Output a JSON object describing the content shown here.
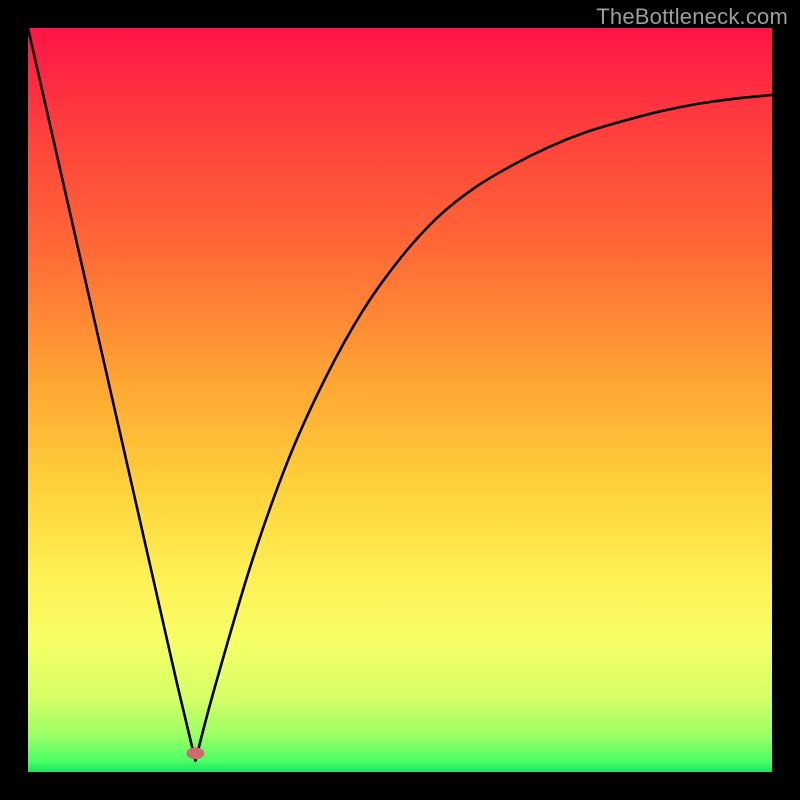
{
  "watermark": "TheBottleneck.com",
  "chart_data": {
    "type": "line",
    "title": "",
    "xlabel": "",
    "ylabel": "",
    "xlim": [
      0,
      100
    ],
    "ylim": [
      0,
      100
    ],
    "grid": false,
    "legend": false,
    "notes": "Heat-map background (red→orange→yellow→green vertical gradient). Black V-shaped curve: steep nearly-linear descent from top-left to a cusp near x≈22, then concave-up rise approaching top-right. Small red-rose marker at the cusp.",
    "marker": {
      "x": 22.5,
      "y": 2.5,
      "color": "#cf6a6f"
    },
    "series": [
      {
        "name": "curve",
        "x": [
          0,
          5,
          10,
          15,
          20,
          22.5,
          25,
          30,
          35,
          40,
          45,
          50,
          55,
          60,
          65,
          70,
          75,
          80,
          85,
          90,
          95,
          100
        ],
        "y": [
          100,
          78,
          56,
          34,
          12,
          1.5,
          11,
          28,
          42,
          53,
          62,
          69,
          74.5,
          78.5,
          81.5,
          84,
          86,
          87.5,
          88.8,
          89.8,
          90.5,
          91
        ]
      }
    ],
    "gradient_stops": [
      {
        "offset": 0.0,
        "color": "#ff1447"
      },
      {
        "offset": 0.13,
        "color": "#ff3d3d"
      },
      {
        "offset": 0.3,
        "color": "#ff6a36"
      },
      {
        "offset": 0.48,
        "color": "#ffa733"
      },
      {
        "offset": 0.62,
        "color": "#ffd23a"
      },
      {
        "offset": 0.74,
        "color": "#fff156"
      },
      {
        "offset": 0.83,
        "color": "#f5ff66"
      },
      {
        "offset": 0.9,
        "color": "#d6ff66"
      },
      {
        "offset": 0.95,
        "color": "#9dff66"
      },
      {
        "offset": 0.985,
        "color": "#4dff66"
      },
      {
        "offset": 1.0,
        "color": "#17e85e"
      }
    ]
  }
}
